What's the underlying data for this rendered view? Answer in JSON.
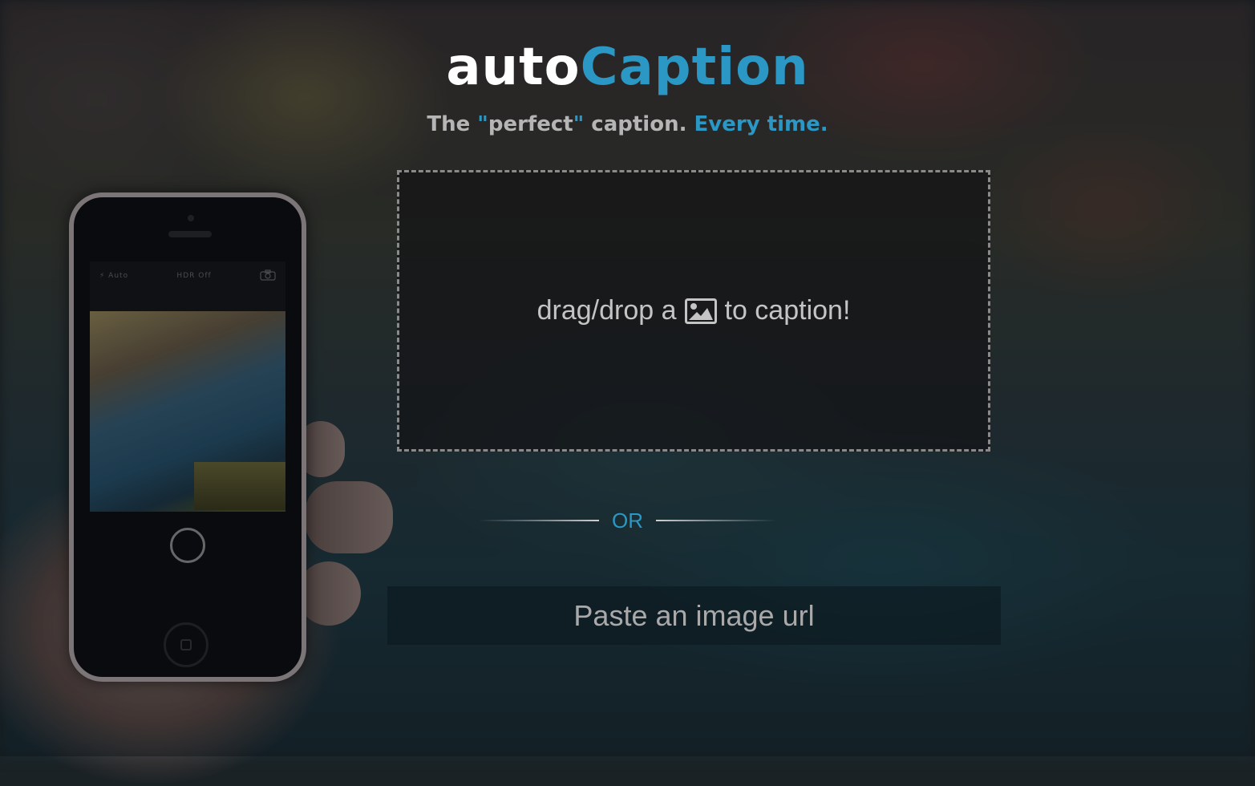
{
  "header": {
    "title_part1": "auto",
    "title_part2": "Caption",
    "tagline_part1": "The ",
    "tagline_quote_open": "\"",
    "tagline_word": "perfect",
    "tagline_quote_close": "\"",
    "tagline_part2": " caption. ",
    "tagline_part3": "Every time."
  },
  "dropzone": {
    "text_before": "drag/drop a",
    "icon": "image-icon",
    "text_after": "to caption!"
  },
  "divider": {
    "label": "OR"
  },
  "url_input": {
    "placeholder": "Paste an image url",
    "value": ""
  },
  "background": {
    "phone_topbar_left": "⚡ Auto",
    "phone_topbar_center": "HDR Off",
    "phone_topbar_icon": "camera-switch-icon"
  },
  "colors": {
    "accent": "#2b97c4",
    "title_white": "#ffffff",
    "tagline_gray": "#b5b5b5"
  }
}
